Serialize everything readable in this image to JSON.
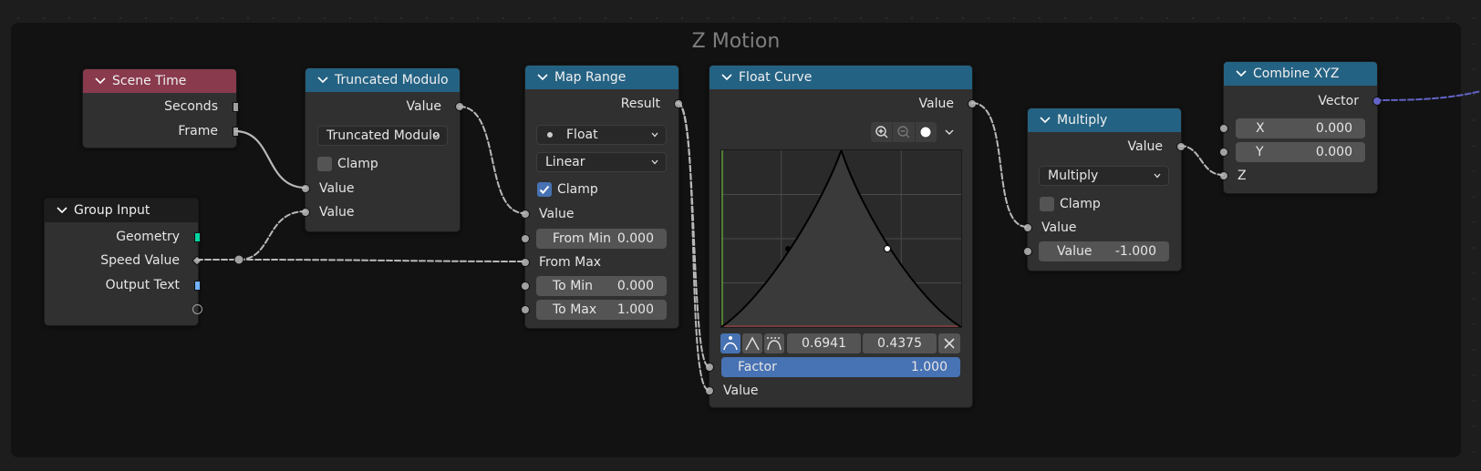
{
  "frame": {
    "title": "Z Motion"
  },
  "nodes": {
    "scene_time": {
      "title": "Scene Time",
      "outputs": [
        "Seconds",
        "Frame"
      ]
    },
    "group_input": {
      "title": "Group Input",
      "outputs": [
        "Geometry",
        "Speed Value",
        "Output Text"
      ]
    },
    "truncated_modulo": {
      "title": "Truncated Modulo",
      "output": "Value",
      "operation": "Truncated Modulo",
      "clamp_label": "Clamp",
      "clamp": false,
      "inputs": [
        "Value",
        "Value"
      ]
    },
    "map_range": {
      "title": "Map Range",
      "output": "Result",
      "data_type": "Float",
      "interpolation": "Linear",
      "clamp_label": "Clamp",
      "clamp": true,
      "value_label": "Value",
      "fields": [
        {
          "label": "From Min",
          "value": "0.000"
        },
        {
          "label": "From Max",
          "value": ""
        },
        {
          "label": "To Min",
          "value": "0.000"
        },
        {
          "label": "To Max",
          "value": "1.000"
        }
      ]
    },
    "float_curve": {
      "title": "Float Curve",
      "output": "Value",
      "point_x": "0.6941",
      "point_y": "0.4375",
      "factor_label": "Factor",
      "factor_value": "1.000",
      "input_label": "Value"
    },
    "multiply": {
      "title": "Multiply",
      "output": "Value",
      "operation": "Multiply",
      "clamp_label": "Clamp",
      "clamp": false,
      "input_label": "Value",
      "value_label": "Value",
      "value": "-1.000"
    },
    "combine_xyz": {
      "title": "Combine XYZ",
      "output": "Vector",
      "x_label": "X",
      "x_value": "0.000",
      "y_label": "Y",
      "y_value": "0.000",
      "z_label": "Z"
    }
  },
  "colors": {
    "input_header": "#893a4d",
    "converter_header": "#246283",
    "geometry_socket": "#00d6a3",
    "string_socket": "#70b2ff",
    "vector_socket": "#6363c7",
    "checkbox_on": "#4772b3"
  },
  "icons": [
    "chevron-down-icon",
    "zoom-in-icon",
    "zoom-out-icon",
    "clip-icon",
    "curve-handle-auto-icon",
    "curve-handle-vector-icon",
    "curve-handle-free-icon",
    "close-icon"
  ]
}
